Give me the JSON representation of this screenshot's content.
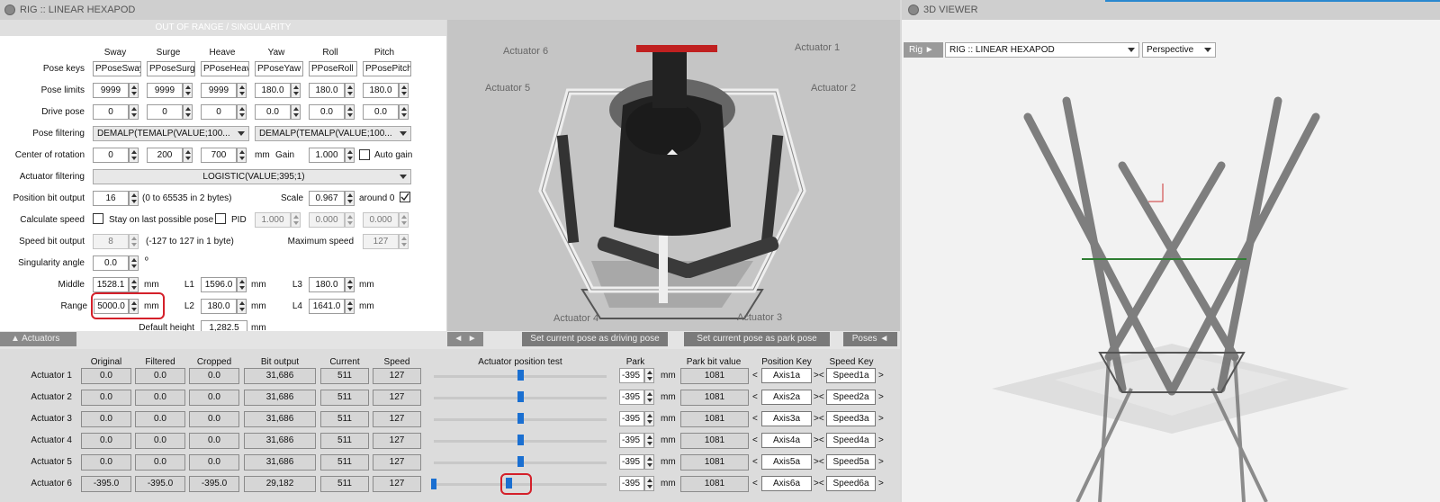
{
  "window": {
    "rig_title": "RIG :: LINEAR HEXAPOD",
    "viewer_title": "3D VIEWER",
    "status_banner": "OUT OF RANGE / SINGULARITY"
  },
  "columns": [
    "Sway",
    "Surge",
    "Heave",
    "Yaw",
    "Roll",
    "Pitch"
  ],
  "rows": {
    "pose_keys": {
      "label": "Pose keys",
      "values": [
        "PPoseSway",
        "PPoseSurge",
        "PPoseHeave",
        "PPoseYaw",
        "PPoseRoll",
        "PPosePitch"
      ]
    },
    "pose_limits": {
      "label": "Pose limits",
      "values": [
        "9999",
        "9999",
        "9999",
        "180.0",
        "180.0",
        "180.0"
      ]
    },
    "drive_pose": {
      "label": "Drive pose",
      "values": [
        "0",
        "0",
        "0",
        "0.0",
        "0.0",
        "0.0"
      ]
    }
  },
  "pose_filtering": {
    "label": "Pose filtering",
    "combo1": "DEMALP(TEMALP(VALUE;100...",
    "combo2": "DEMALP(TEMALP(VALUE;100..."
  },
  "center_of_rotation": {
    "label": "Center of rotation",
    "values": [
      "0",
      "200",
      "700"
    ],
    "unit": "mm",
    "gain_label": "Gain",
    "gain": "1.000",
    "auto_gain_label": "Auto gain"
  },
  "actuator_filtering": {
    "label": "Actuator filtering",
    "value": "LOGISTIC(VALUE;395;1)"
  },
  "position_bit_output": {
    "label": "Position bit output",
    "value": "16",
    "hint": "(0 to 65535 in 2 bytes)",
    "scale_label": "Scale",
    "scale": "0.967",
    "around_label": "around 0"
  },
  "calculate_speed": {
    "label": "Calculate speed",
    "stay_label": "Stay on last possible pose",
    "pid_label": "PID",
    "pid": [
      "1.000",
      "0.000",
      "0.000"
    ]
  },
  "speed_bit_output": {
    "label": "Speed bit output",
    "value": "8",
    "hint": "(-127 to 127 in 1 byte)",
    "max_label": "Maximum speed",
    "max": "127"
  },
  "singularity_angle": {
    "label": "Singularity angle",
    "value": "0.0",
    "unit": "º"
  },
  "geometry": {
    "middle_label": "Middle",
    "middle": "1528.1",
    "range_label": "Range",
    "range": "5000.0",
    "l1_label": "L1",
    "l1": "1596.0",
    "l2_label": "L2",
    "l2": "180.0",
    "l3_label": "L3",
    "l3": "180.0",
    "l4_label": "L4",
    "l4": "1641.0",
    "unit": "mm",
    "default_height_label": "Default height",
    "default_height": "1,282.5"
  },
  "image_callouts": [
    "Actuator 6",
    "Actuator 1",
    "Actuator 5",
    "Actuator 2",
    "Actuator 4",
    "Actuator 3"
  ],
  "toolbar": {
    "actuators_tab": "Actuators",
    "set_driving": "Set current pose as driving pose",
    "set_park": "Set current pose as park pose",
    "poses": "Poses"
  },
  "table": {
    "headers": [
      "Original",
      "Filtered",
      "Cropped",
      "Bit output",
      "Current",
      "Speed",
      "Actuator position test",
      "Park",
      "Park bit value",
      "Position Key",
      "Speed Key"
    ],
    "unit": "mm",
    "rows": [
      {
        "name": "Actuator 1",
        "original": "0.0",
        "filtered": "0.0",
        "cropped": "0.0",
        "bit": "31,686",
        "current": "511",
        "speed": "127",
        "test_level": 0.5,
        "park": "-395",
        "park_bit": "1081",
        "pos_key": "Axis1a",
        "speed_key": "Speed1a"
      },
      {
        "name": "Actuator 2",
        "original": "0.0",
        "filtered": "0.0",
        "cropped": "0.0",
        "bit": "31,686",
        "current": "511",
        "speed": "127",
        "test_level": 0.5,
        "park": "-395",
        "park_bit": "1081",
        "pos_key": "Axis2a",
        "speed_key": "Speed2a"
      },
      {
        "name": "Actuator 3",
        "original": "0.0",
        "filtered": "0.0",
        "cropped": "0.0",
        "bit": "31,686",
        "current": "511",
        "speed": "127",
        "test_level": 0.5,
        "park": "-395",
        "park_bit": "1081",
        "pos_key": "Axis3a",
        "speed_key": "Speed3a"
      },
      {
        "name": "Actuator 4",
        "original": "0.0",
        "filtered": "0.0",
        "cropped": "0.0",
        "bit": "31,686",
        "current": "511",
        "speed": "127",
        "test_level": 0.5,
        "park": "-395",
        "park_bit": "1081",
        "pos_key": "Axis4a",
        "speed_key": "Speed4a"
      },
      {
        "name": "Actuator 5",
        "original": "0.0",
        "filtered": "0.0",
        "cropped": "0.0",
        "bit": "31,686",
        "current": "511",
        "speed": "127",
        "test_level": 0.5,
        "park": "-395",
        "park_bit": "1081",
        "pos_key": "Axis5a",
        "speed_key": "Speed5a"
      },
      {
        "name": "Actuator 6",
        "original": "-395.0",
        "filtered": "-395.0",
        "cropped": "-395.0",
        "bit": "29,182",
        "current": "511",
        "speed": "127",
        "test_level": 0.43,
        "park": "-395",
        "park_bit": "1081",
        "pos_key": "Axis6a",
        "speed_key": "Speed6a"
      }
    ]
  },
  "viewer": {
    "rig_label": "Rig",
    "rig_value": "RIG :: LINEAR HEXAPOD",
    "view_value": "Perspective"
  },
  "colors": {
    "highlight": "#d4202a",
    "slider": "#1a6fd1",
    "title_accent": "#2a88cf"
  },
  "icons": [
    "rig-icon",
    "viewer-icon",
    "spin-icon",
    "chevron-down-icon",
    "checkbox-icon",
    "play-icon"
  ]
}
